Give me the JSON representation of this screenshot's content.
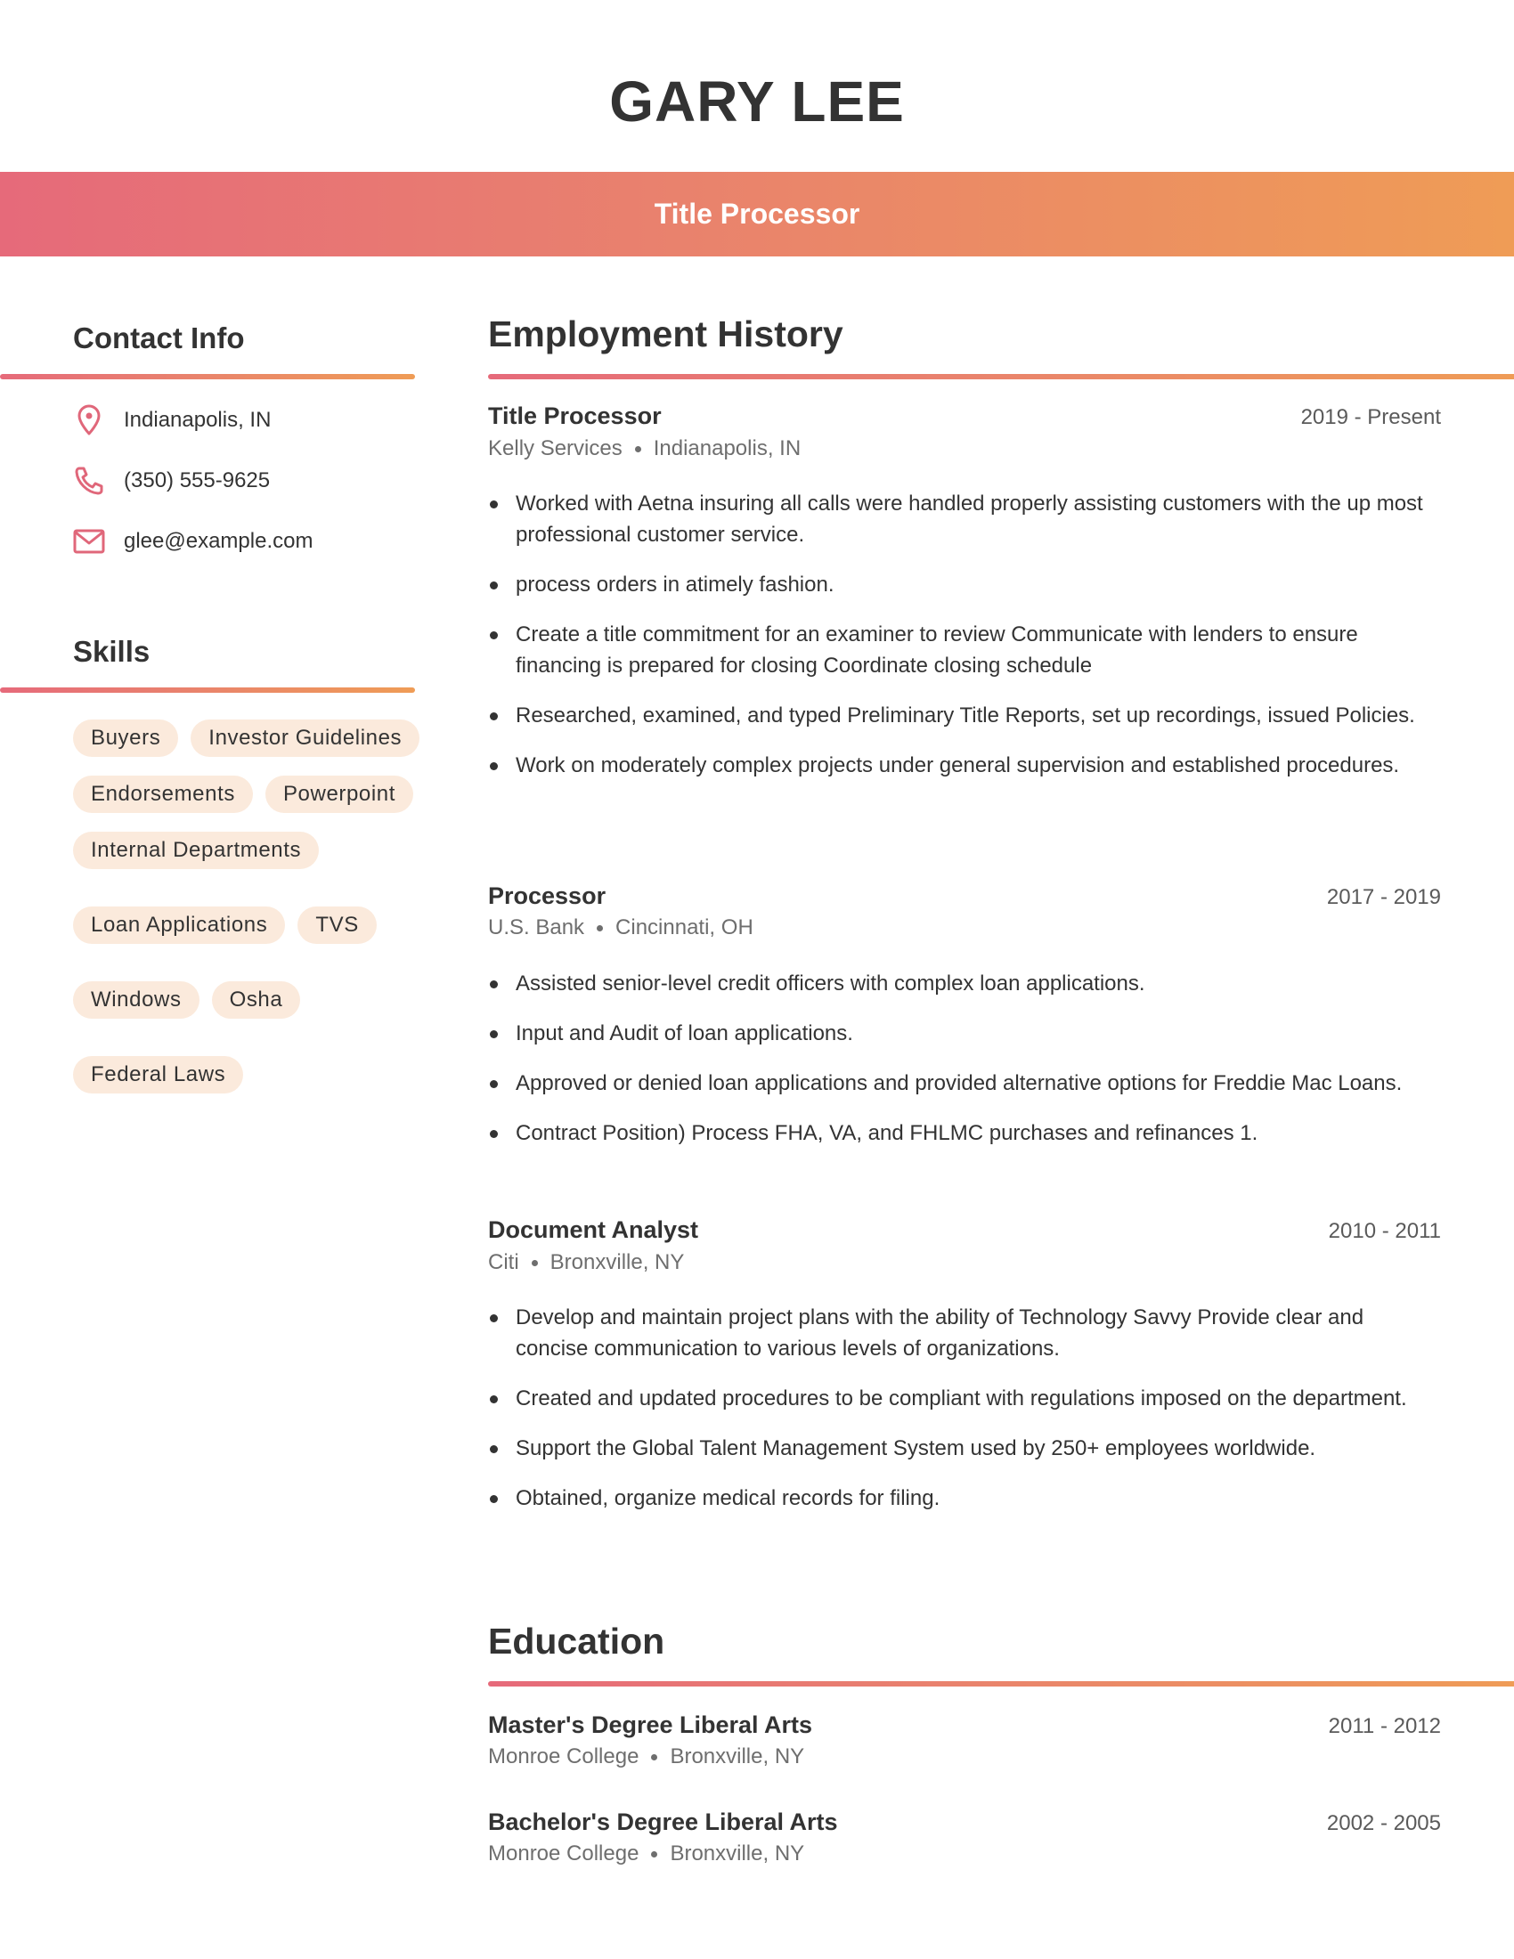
{
  "header": {
    "name": "GARY LEE",
    "title": "Title Processor"
  },
  "colors": {
    "gradient_start": "#E66A7A",
    "gradient_end": "#EF9C56",
    "tag_background": "#FBEADC",
    "icon": "#E0677A",
    "text": "#333333"
  },
  "contact": {
    "heading": "Contact Info",
    "items": [
      {
        "icon": "map-pin-icon",
        "text": "Indianapolis, IN"
      },
      {
        "icon": "phone-icon",
        "text": "(350) 555-9625"
      },
      {
        "icon": "mail-icon",
        "text": "glee@example.com"
      }
    ]
  },
  "skills": {
    "heading": "Skills",
    "items": [
      "Buyers",
      "Investor Guidelines",
      "Endorsements",
      "Powerpoint",
      "Internal Departments",
      "Loan Applications",
      "TVS",
      "Windows",
      "Osha",
      "Federal Laws"
    ]
  },
  "employment": {
    "heading": "Employment History",
    "jobs": [
      {
        "title": "Title Processor",
        "dates": "2019 - Present",
        "company": "Kelly Services",
        "location": "Indianapolis, IN",
        "bullets": [
          "Worked with Aetna insuring all calls were handled properly assisting customers with the up most professional customer service.",
          "process orders in atimely fashion.",
          "Create a title commitment for an examiner to review Communicate with lenders to ensure financing is prepared for closing Coordinate closing schedule",
          "Researched, examined, and typed Preliminary Title Reports, set up recordings, issued Policies.",
          "Work on moderately complex projects under general supervision and established procedures."
        ]
      },
      {
        "title": "Processor",
        "dates": "2017 - 2019",
        "company": "U.S. Bank",
        "location": "Cincinnati, OH",
        "bullets": [
          "Assisted senior-level credit officers with complex loan applications.",
          "Input and Audit of loan applications.",
          "Approved or denied loan applications and provided alternative options for Freddie Mac Loans.",
          "Contract Position) Process FHA, VA, and FHLMC purchases and refinances 1."
        ]
      },
      {
        "title": "Document Analyst",
        "dates": "2010 - 2011",
        "company": "Citi",
        "location": "Bronxville, NY",
        "bullets": [
          "Develop and maintain project plans with the ability of Technology Savvy Provide clear and concise communication to various levels of organizations.",
          "Created and updated procedures to be compliant with regulations imposed on the department.",
          "Support the Global Talent Management System used by 250+ employees worldwide.",
          "Obtained, organize medical records for filing."
        ]
      }
    ]
  },
  "education": {
    "heading": "Education",
    "items": [
      {
        "degree": "Master's Degree Liberal Arts",
        "dates": "2011 - 2012",
        "school": "Monroe College",
        "location": "Bronxville, NY"
      },
      {
        "degree": "Bachelor's Degree Liberal Arts",
        "dates": "2002 - 2005",
        "school": "Monroe College",
        "location": "Bronxville, NY"
      }
    ]
  }
}
